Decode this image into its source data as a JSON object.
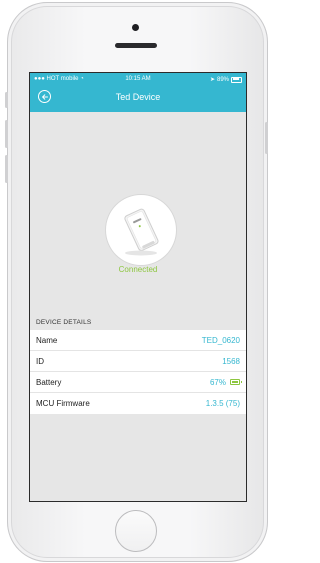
{
  "status_bar": {
    "carrier": "HOT mobile",
    "time": "10:15 AM",
    "battery": "89%"
  },
  "nav": {
    "title": "Ted Device"
  },
  "device": {
    "connection_status": "Connected"
  },
  "details": {
    "section_title": "DEVICE DETAILS",
    "rows": [
      {
        "label": "Name",
        "value": "TED_0620"
      },
      {
        "label": "ID",
        "value": "1568"
      },
      {
        "label": "Battery",
        "value": "67%"
      },
      {
        "label": "MCU Firmware",
        "value": "1.3.5 (75)"
      }
    ]
  },
  "colors": {
    "accent": "#35b7d0",
    "connected_green": "#8dc63f"
  }
}
